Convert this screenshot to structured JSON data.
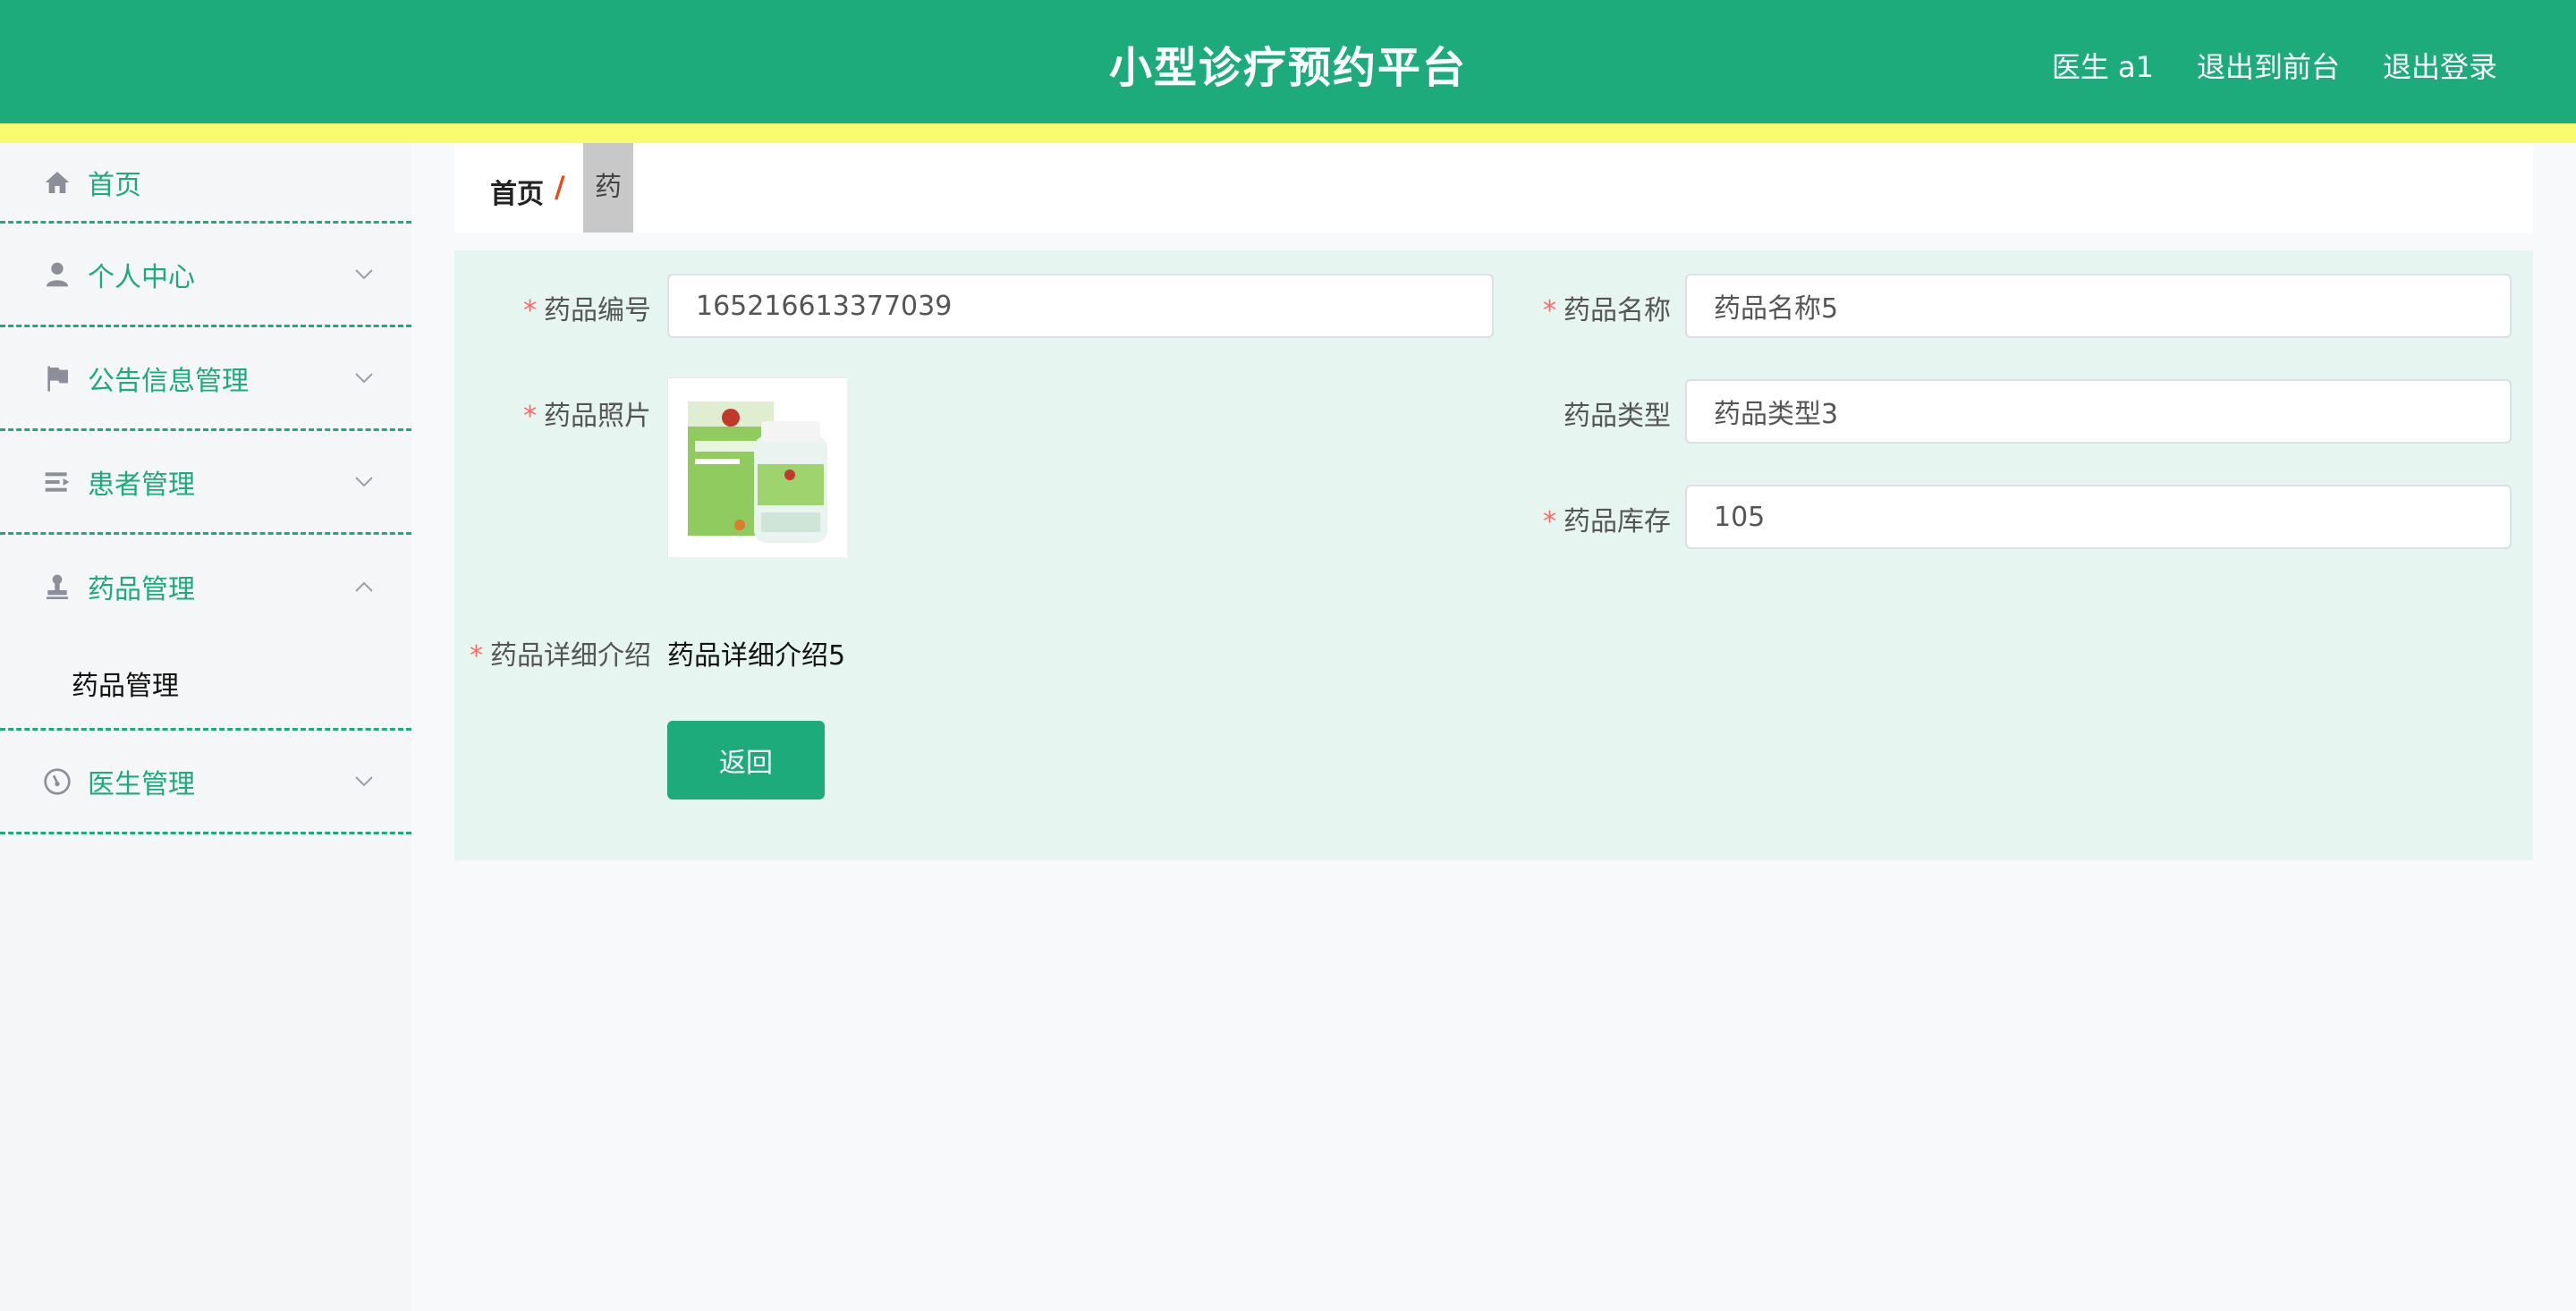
{
  "header": {
    "title": "小型诊疗预约平台",
    "links": [
      "医生 a1",
      "退出到前台",
      "退出登录"
    ]
  },
  "colors": {
    "brand": "#1dab7b",
    "stripe": "#f9fb6f",
    "panel": "#e6f5ef",
    "required": "#f56c6c"
  },
  "sidebar": {
    "items": [
      {
        "label": "首页",
        "icon": "home-icon"
      },
      {
        "label": "个人中心",
        "icon": "user-icon"
      },
      {
        "label": "公告信息管理",
        "icon": "flag-icon"
      },
      {
        "label": "患者管理",
        "icon": "list-icon"
      },
      {
        "label": "药品管理",
        "icon": "stamp-icon",
        "expanded": true,
        "children": [
          "药品管理"
        ]
      },
      {
        "label": "医生管理",
        "icon": "gauge-icon"
      }
    ]
  },
  "breadcrumb": {
    "home": "首页",
    "separator": "/",
    "current": "药品"
  },
  "form": {
    "code": {
      "label": "药品编号",
      "value": "165216613377039"
    },
    "name": {
      "label": "药品名称",
      "value": "药品名称5"
    },
    "photo": {
      "label": "药品照片"
    },
    "type": {
      "label": "药品类型",
      "value": "药品类型3"
    },
    "stock": {
      "label": "药品库存",
      "value": "105"
    },
    "detail": {
      "label": "药品详细介绍",
      "value": "药品详细介绍5"
    },
    "required_mark": "*",
    "back_label": "返回"
  }
}
